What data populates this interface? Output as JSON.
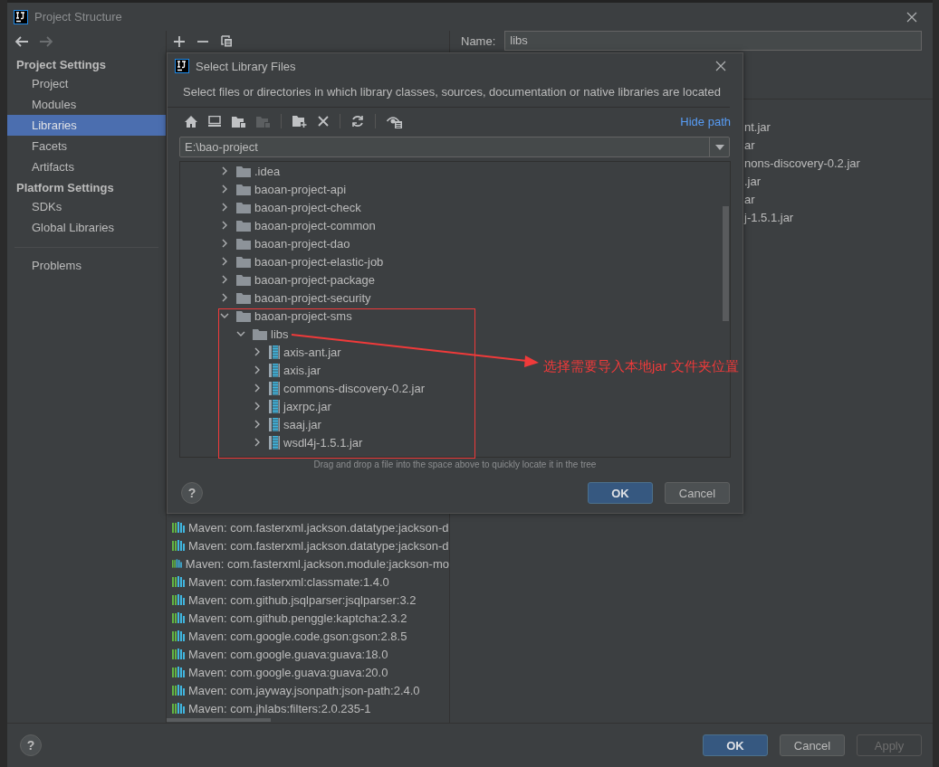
{
  "window": {
    "title": "Project Structure"
  },
  "sidebar": {
    "sections": [
      {
        "heading": "Project Settings",
        "items": [
          {
            "label": "Project",
            "selected": false
          },
          {
            "label": "Modules",
            "selected": false
          },
          {
            "label": "Libraries",
            "selected": true
          },
          {
            "label": "Facets",
            "selected": false
          },
          {
            "label": "Artifacts",
            "selected": false
          }
        ]
      },
      {
        "heading": "Platform Settings",
        "items": [
          {
            "label": "SDKs",
            "selected": false
          },
          {
            "label": "Global Libraries",
            "selected": false
          }
        ]
      }
    ],
    "extra_items": [
      {
        "label": "Problems",
        "selected": false
      }
    ]
  },
  "libraries": {
    "items": [
      "Maven: com.fasterxml.jackson.datatype:jackson-d",
      "Maven: com.fasterxml.jackson.datatype:jackson-d",
      "Maven: com.fasterxml.jackson.module:jackson-mo",
      "Maven: com.fasterxml:classmate:1.4.0",
      "Maven: com.github.jsqlparser:jsqlparser:3.2",
      "Maven: com.github.penggle:kaptcha:2.3.2",
      "Maven: com.google.code.gson:gson:2.8.5",
      "Maven: com.google.guava:guava:18.0",
      "Maven: com.google.guava:guava:20.0",
      "Maven: com.jayway.jsonpath:json-path:2.4.0",
      "Maven: com.jhlabs:filters:2.0.235-1"
    ]
  },
  "library_detail": {
    "name_label": "Name:",
    "name_value": "libs",
    "tree_fragments": [
      "nt.jar",
      "ar",
      "nons-discovery-0.2.jar",
      ".jar",
      "ar",
      "j-1.5.1.jar"
    ]
  },
  "dialog": {
    "title": "Select Library Files",
    "description": "Select files or directories in which library classes, sources, documentation or native libraries are located",
    "hide_path_link": "Hide path",
    "path": "E:\\bao-project",
    "tree": [
      {
        "label": ".idea",
        "kind": "folder",
        "expanded": false
      },
      {
        "label": "baoan-project-api",
        "kind": "folder",
        "expanded": false
      },
      {
        "label": "baoan-project-check",
        "kind": "folder",
        "expanded": false
      },
      {
        "label": "baoan-project-common",
        "kind": "folder",
        "expanded": false
      },
      {
        "label": "baoan-project-dao",
        "kind": "folder",
        "expanded": false
      },
      {
        "label": "baoan-project-elastic-job",
        "kind": "folder",
        "expanded": false
      },
      {
        "label": "baoan-project-package",
        "kind": "folder",
        "expanded": false
      },
      {
        "label": "baoan-project-security",
        "kind": "folder",
        "expanded": false
      },
      {
        "label": "baoan-project-sms",
        "kind": "folder",
        "expanded": true,
        "children": [
          {
            "label": "libs",
            "kind": "folder",
            "expanded": true,
            "children": [
              {
                "label": "axis-ant.jar",
                "kind": "jar",
                "expanded": false
              },
              {
                "label": "axis.jar",
                "kind": "jar",
                "expanded": false
              },
              {
                "label": "commons-discovery-0.2.jar",
                "kind": "jar",
                "expanded": false
              },
              {
                "label": "jaxrpc.jar",
                "kind": "jar",
                "expanded": false
              },
              {
                "label": "saaj.jar",
                "kind": "jar",
                "expanded": false
              },
              {
                "label": "wsdl4j-1.5.1.jar",
                "kind": "jar",
                "expanded": false
              }
            ]
          }
        ]
      }
    ],
    "hint": "Drag and drop a file into the space above to quickly locate it in the tree",
    "help_label": "?",
    "buttons": [
      {
        "label": "OK",
        "kind": "primary",
        "disabled": false
      },
      {
        "label": "Cancel",
        "kind": "secondary",
        "disabled": false
      }
    ]
  },
  "annotation": {
    "text": "选择需要导入本地jar 文件夹位置"
  },
  "footer": {
    "help_label": "?",
    "buttons": [
      {
        "label": "OK",
        "kind": "primary",
        "disabled": false
      },
      {
        "label": "Cancel",
        "kind": "secondary",
        "disabled": false
      },
      {
        "label": "Apply",
        "kind": "secondary",
        "disabled": true
      }
    ]
  }
}
